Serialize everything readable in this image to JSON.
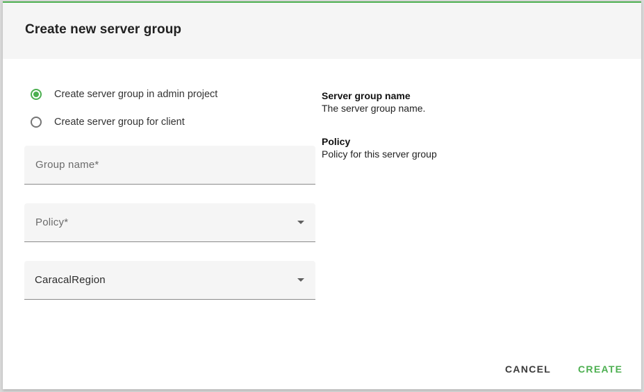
{
  "dialog": {
    "title": "Create new server group"
  },
  "options": [
    {
      "label": "Create server group in admin project",
      "checked": true
    },
    {
      "label": "Create server group for client",
      "checked": false
    }
  ],
  "form": {
    "group_name": {
      "label": "Group name*",
      "value": ""
    },
    "policy": {
      "label": "Policy*",
      "value": ""
    },
    "region": {
      "value": "CaracalRegion"
    }
  },
  "help": {
    "group_name_title": "Server group name",
    "group_name_text": "The server group name.",
    "policy_title": "Policy",
    "policy_text": "Policy for this server group"
  },
  "actions": {
    "cancel": "CANCEL",
    "create": "CREATE"
  },
  "colors": {
    "accent": "#4caf50",
    "header_bg": "#f5f5f5",
    "field_bg": "#f5f5f5"
  },
  "icons": {
    "policy_dropdown": "caret-down-icon",
    "region_dropdown": "caret-down-icon",
    "radio_checked": "radio-checked-icon",
    "radio_unchecked": "radio-unchecked-icon"
  }
}
